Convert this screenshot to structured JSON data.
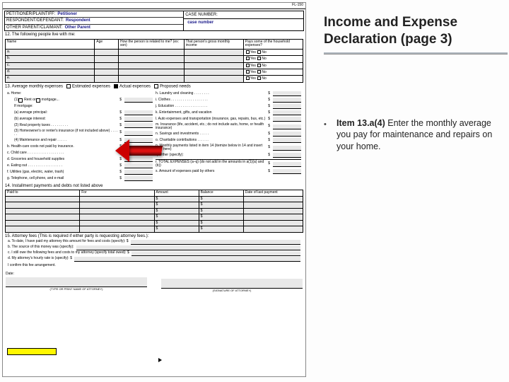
{
  "right": {
    "title_line1": "Income and Expense",
    "title_line2": "Declaration (page 3)",
    "bullet_lead": "Item 13.a(4) ",
    "bullet_rest": "Enter the monthly average you pay for maintenance and repairs on your home."
  },
  "form": {
    "code": "FL-150",
    "parties": {
      "petitioner_label": "PETITIONER/PLAINTIFF:",
      "petitioner_value": "Petitioner",
      "respondent_label": "RESPONDENT/DEFENDANT:",
      "respondent_value": "Respondent",
      "other_label": "OTHER PARENT/CLAIMANT:",
      "other_value": "Other Parent",
      "case_label": "CASE NUMBER:",
      "case_value": "case number"
    },
    "s12": {
      "title": "12.  The following people live with me:",
      "cols": [
        "Name",
        "Age",
        "How the person is related to me? (ex: son)",
        "That person's gross monthly income",
        "Pays some of the household expenses?"
      ],
      "rows": [
        "a.",
        "b.",
        "c.",
        "d.",
        "e."
      ],
      "yes": "Yes",
      "no": "No"
    },
    "s13": {
      "title": "13.  Average monthly expenses",
      "opt1": "Estimated expenses",
      "opt2": "Actual expenses",
      "opt3": "Proposed needs",
      "left": {
        "a": "a.  Home:",
        "a1": "(1)",
        "a1_rent": "Rent or",
        "a1_mort": "mortgage...",
        "a1_if": "If mortgage:",
        "a1a": "(a)  average principal:",
        "a1b": "(b)  average interest:",
        "a2": "(2)  Real property taxes  . . . . . . . . .",
        "a3": "(3)  Homeowner's or renter's insurance (if not included above)  . . . . . .",
        "a4": "(4)  Maintenance and repair  . . . . .",
        "b": "b.  Health-care costs not paid by insurance.",
        "c": "c.  Child care  . . . . . . . . . . . . . . . . . . .",
        "d": "d.  Groceries and household supplies",
        "e": "e.  Eating out  . . . . . . . . . . . . . . . . . .",
        "f": "f.  Utilities (gas, electric, water, trash)",
        "g": "g.  Telephone, cell phone, and e-mail"
      },
      "right": {
        "h": "h.  Laundry and cleaning  . . . . . . . .",
        "i": "i.  Clothes  . . . . . . . . . . . . . . . . . . .",
        "j": "j.  Education  . . . . . . . . . . . . . . . . .",
        "k": "k.  Entertainment, gifts, and vacation",
        "l": "l.  Auto expenses and transportation (insurance, gas, repairs, bus, etc.)",
        "m": "m.  Insurance (life, accident, etc.; do not include auto, home, or health insurance)",
        "n": "n.  Savings and investments  . . . . .",
        "o": "o.  Charitable contributions  . . . . . .",
        "p": "p.  Monthly payments listed in item 14 (itemize below in 14 and insert total here)",
        "q": "q.  Other (specify):",
        "r_total": "r.  TOTAL EXPENSES (a–q) (do not add in the amounts in a(1)(a) and (b))",
        "s": "s.  Amount of expenses paid by others"
      }
    },
    "s14": {
      "title": "14.  Installment payments and debts not listed above",
      "cols": [
        "Paid to",
        "For",
        "Amount",
        "Balance",
        "Date of last payment"
      ]
    },
    "s15": {
      "title": "15.  Attorney fees (This is required if either party is requesting attorney fees.):",
      "a": "a.  To date, I have paid my attorney this amount for fees and costs (specify):  $",
      "b": "b.  The source of this money was (specify):",
      "c": "c.  I still owe the following fees and costs to my attorney (specify total owed):  $",
      "d": "d.  My attorney's hourly rate is (specify):  $",
      "confirm": "I confirm this fee arrangement."
    },
    "sig": {
      "date": "Date:",
      "name_caption": "(TYPE OR PRINT NAME OF ATTORNEY)",
      "sig_caption": "(SIGNATURE OF ATTORNEY)"
    }
  }
}
